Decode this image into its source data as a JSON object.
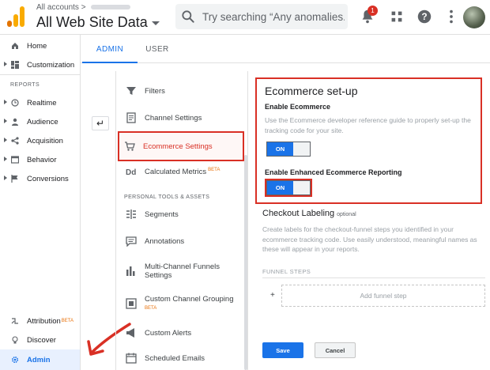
{
  "header": {
    "breadcrumb": "All accounts >",
    "title": "All Web Site Data",
    "search_placeholder": "Try searching “Any anomalies...",
    "notification_count": "1"
  },
  "tabs": [
    {
      "label": "ADMIN",
      "active": true
    },
    {
      "label": "USER",
      "active": false
    }
  ],
  "leftnav": {
    "top_items": [
      {
        "label": "Home",
        "icon": "home-icon"
      },
      {
        "label": "Customization",
        "icon": "dashboard-icon"
      }
    ],
    "reports_heading": "REPORTS",
    "report_items": [
      {
        "label": "Realtime",
        "icon": "clock-icon"
      },
      {
        "label": "Audience",
        "icon": "person-icon"
      },
      {
        "label": "Acquisition",
        "icon": "share-icon"
      },
      {
        "label": "Behavior",
        "icon": "window-icon"
      },
      {
        "label": "Conversions",
        "icon": "flag-icon"
      }
    ],
    "bottom_items": [
      {
        "label": "Attribution",
        "beta": "BETA",
        "icon": "attribution-icon"
      },
      {
        "label": "Discover",
        "icon": "lightbulb-icon"
      },
      {
        "label": "Admin",
        "icon": "gear-icon",
        "active": true
      }
    ]
  },
  "settings": {
    "items": [
      {
        "label": "Filters",
        "icon": "filter-icon"
      },
      {
        "label": "Channel Settings",
        "icon": "document-icon"
      },
      {
        "label": "Ecommerce Settings",
        "icon": "cart-icon",
        "active": true
      },
      {
        "label": "Calculated Metrics",
        "beta": "BETA",
        "icon": "dd-icon"
      }
    ],
    "personal_heading": "PERSONAL TOOLS & ASSETS",
    "personal_items": [
      {
        "label": "Segments",
        "icon": "segments-icon"
      },
      {
        "label": "Annotations",
        "icon": "comment-icon"
      },
      {
        "label": "Multi-Channel Funnels Settings",
        "icon": "bar-chart-icon"
      },
      {
        "label": "Custom Channel Grouping",
        "beta": "BETA",
        "icon": "grouping-icon"
      },
      {
        "label": "Custom Alerts",
        "icon": "megaphone-icon"
      },
      {
        "label": "Scheduled Emails",
        "icon": "calendar-icon"
      }
    ]
  },
  "ecommerce": {
    "heading": "Ecommerce set-up",
    "enable_label": "Enable Ecommerce",
    "enable_desc": "Use the Ecommerce developer reference guide to properly set-up the tracking code for your site.",
    "enable_toggle": "ON",
    "enhanced_label": "Enable Enhanced Ecommerce Reporting",
    "enhanced_toggle": "ON"
  },
  "checkout": {
    "heading": "Checkout Labeling",
    "optional": "optional",
    "desc": "Create labels for the checkout-funnel steps you identified in your ecommerce tracking code. Use easily understood, meaningful names as these will appear in your reports.",
    "funnel_heading": "FUNNEL STEPS",
    "plus": "+",
    "add_step": "Add funnel step"
  },
  "actions": {
    "save": "Save",
    "cancel": "Cancel"
  },
  "colors": {
    "accent": "#1a73e8",
    "highlight": "#d93025",
    "beta": "#e8710a"
  }
}
